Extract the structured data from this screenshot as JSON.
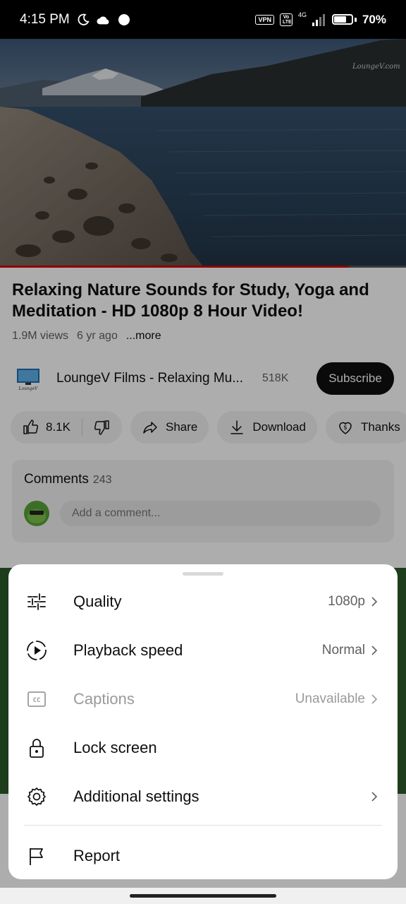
{
  "status_bar": {
    "time": "4:15 PM",
    "vpn": "VPN",
    "volte": "Vo LTE",
    "network": "4G",
    "battery_level": 0.7,
    "battery": "70%"
  },
  "video": {
    "watermark": "LoungeV.com",
    "progress": 0.86
  },
  "details": {
    "title": "Relaxing Nature Sounds for Study, Yoga and Meditation - HD 1080p 8 Hour Video!",
    "views": "1.9M views",
    "age": "6 yr ago",
    "more": "...more",
    "channel_name": "LoungeV Films - Relaxing Mu...",
    "subscribers": "518K",
    "subscribe_label": "Subscribe",
    "logo_text": "LoungeV"
  },
  "actions": {
    "likes": "8.1K",
    "share": "Share",
    "download": "Download",
    "thanks": "Thanks"
  },
  "comments": {
    "title": "Comments",
    "count": "243",
    "placeholder": "Add a comment..."
  },
  "settings_sheet": {
    "items": [
      {
        "label": "Quality",
        "value": "1080p",
        "icon": "sliders-icon",
        "disabled": false
      },
      {
        "label": "Playback speed",
        "value": "Normal",
        "icon": "playback-speed-icon",
        "disabled": false
      },
      {
        "label": "Captions",
        "value": "Unavailable",
        "icon": "captions-icon",
        "disabled": true
      },
      {
        "label": "Lock screen",
        "value": "",
        "icon": "lock-icon",
        "disabled": false
      },
      {
        "label": "Additional settings",
        "value": "",
        "icon": "gear-icon",
        "disabled": false
      },
      {
        "label": "Report",
        "value": "",
        "icon": "flag-icon",
        "disabled": false
      }
    ]
  }
}
